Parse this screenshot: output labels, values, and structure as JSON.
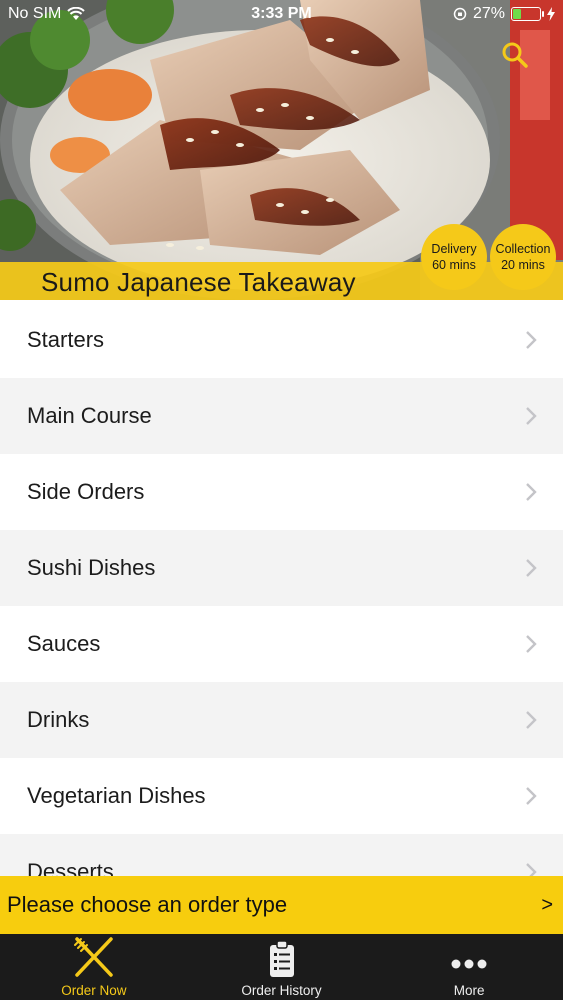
{
  "status_bar": {
    "carrier": "No SIM",
    "time": "3:33 PM",
    "battery_percent": "27%",
    "battery_level": 0.27
  },
  "header": {
    "restaurant_name": "Sumo Japanese Takeaway",
    "search_icon": "search-icon",
    "delivery": {
      "label": "Delivery",
      "time": "60 mins"
    },
    "collection": {
      "label": "Collection",
      "time": "20 mins"
    }
  },
  "menu": {
    "items": [
      {
        "label": "Starters"
      },
      {
        "label": "Main Course"
      },
      {
        "label": "Side Orders"
      },
      {
        "label": "Sushi Dishes"
      },
      {
        "label": "Sauces"
      },
      {
        "label": "Drinks"
      },
      {
        "label": "Vegetarian Dishes"
      },
      {
        "label": "Desserts"
      }
    ]
  },
  "order_type_bar": {
    "text": "Please choose an order type",
    "arrow": ">"
  },
  "tab_bar": {
    "tabs": [
      {
        "label": "Order Now",
        "icon": "fork-knife-icon",
        "active": true
      },
      {
        "label": "Order History",
        "icon": "clipboard-list-icon",
        "active": false
      },
      {
        "label": "More",
        "icon": "more-dots-icon",
        "active": false
      }
    ]
  },
  "colors": {
    "accent": "#f5c919",
    "tab_bar_bg": "#1b1b1b",
    "row_alt_bg": "#f3f3f3"
  }
}
